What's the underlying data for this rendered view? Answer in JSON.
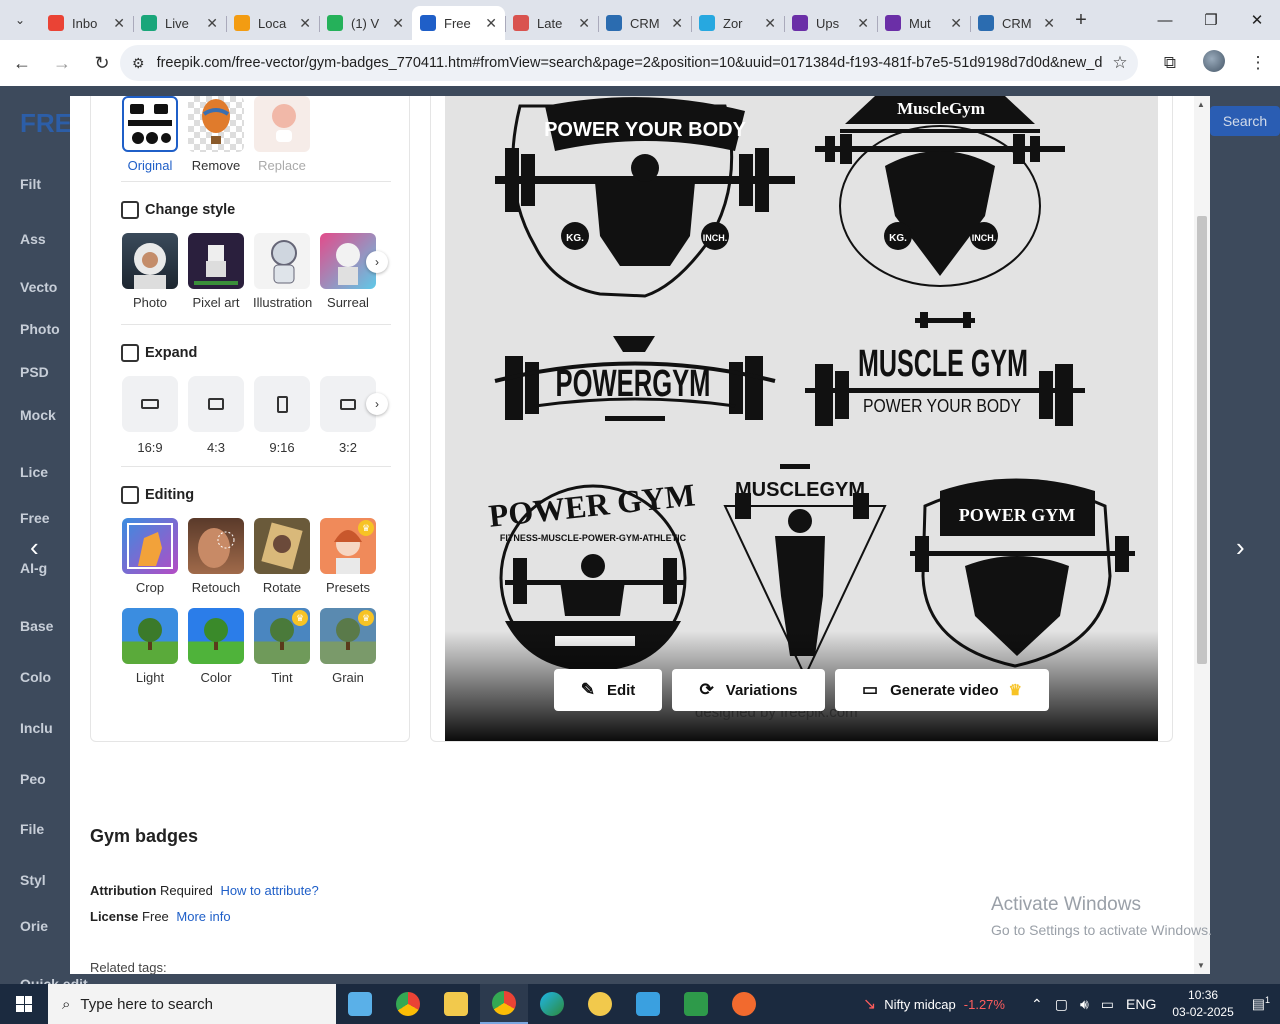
{
  "browser": {
    "tabs": [
      {
        "title": "Inbo",
        "icon": "gmail-icon",
        "color": "#ea4335",
        "active": false
      },
      {
        "title": "Live",
        "icon": "cb-icon",
        "color": "#1aa67a",
        "active": false
      },
      {
        "title": "Loca",
        "icon": "orange-circle-icon",
        "color": "#f39c12",
        "active": false
      },
      {
        "title": "(1) V",
        "icon": "whatsapp-icon",
        "color": "#25b15a",
        "active": false
      },
      {
        "title": "Free",
        "icon": "freepik-icon",
        "color": "#1f5fc8",
        "active": true
      },
      {
        "title": "Late",
        "icon": "maps-icon",
        "color": "#d9534f",
        "active": false
      },
      {
        "title": "CRM",
        "icon": "crm-icon",
        "color": "#2b6cb0",
        "active": false
      },
      {
        "title": "Zor",
        "icon": "zoho-icon",
        "color": "#27a8e0",
        "active": false
      },
      {
        "title": "Ups",
        "icon": "upwork-icon",
        "color": "#6b2fa7",
        "active": false
      },
      {
        "title": "Mut",
        "icon": "upwork-icon",
        "color": "#6b2fa7",
        "active": false
      },
      {
        "title": "CRM",
        "icon": "crm-icon",
        "color": "#2b6cb0",
        "active": false
      }
    ],
    "url": "freepik.com/free-vector/gym-badges_770411.htm#fromView=search&page=2&position=10&uuid=0171384d-f193-481f-b7e5-51d9198d7d0d&new_d..."
  },
  "background": {
    "sidebar": [
      "Filt",
      "Ass",
      "Vecto",
      "Photo",
      "PSD",
      "Mock",
      "Lice",
      "Free",
      "AI-g",
      "Base",
      "Colo",
      "Inclu",
      "Peo",
      "File",
      "Styl",
      "Orie",
      "Quick edit"
    ],
    "logo": "FRE",
    "right_button": "Search"
  },
  "panel": {
    "top_items": [
      {
        "label": "Original",
        "selected": true
      },
      {
        "label": "Remove",
        "selected": false
      },
      {
        "label": "Replace",
        "selected": false,
        "dim": true
      }
    ],
    "change_style": {
      "title": "Change style",
      "items": [
        "Photo",
        "Pixel art",
        "Illustration",
        "Surreal"
      ]
    },
    "expand": {
      "title": "Expand",
      "items": [
        "16:9",
        "4:3",
        "9:16",
        "3:2"
      ]
    },
    "editing": {
      "title": "Editing",
      "row1": [
        "Crop",
        "Retouch",
        "Rotate",
        "Presets"
      ],
      "row2": [
        "Light",
        "Color",
        "Tint",
        "Grain"
      ]
    }
  },
  "preview": {
    "badges": {
      "b1_top": "POWER YOUR BODY",
      "b1_left": "KG.",
      "b1_right": "INCH.",
      "b2_top": "MuscleGym",
      "b2_left": "KG.",
      "b2_right": "INCH.",
      "b3": "POWERGYM",
      "b4_main": "MUSCLE GYM",
      "b4_sub": "POWER YOUR BODY",
      "b5_arc": "POWER GYM",
      "b5_inner": "FITNESS-MUSCLE-POWER-GYM-ATHLETIC",
      "b6": "MUSCLEGYM",
      "b7": "POWER GYM"
    },
    "watermark": "designed by freepik.com",
    "actions": {
      "edit": "Edit",
      "variations": "Variations",
      "generate_video": "Generate video"
    }
  },
  "details": {
    "title": "Gym badges",
    "attribution_label": "Attribution",
    "attribution_value": "Required",
    "attribution_link": "How to attribute?",
    "license_label": "License",
    "license_value": "Free",
    "license_link": "More info",
    "related": "Related tags:"
  },
  "windows_notice": {
    "line1": "Activate Windows",
    "line2": "Go to Settings to activate Windows."
  },
  "taskbar": {
    "search_placeholder": "Type here to search",
    "nifty_label": "Nifty midcap",
    "nifty_change": "-1.27%",
    "language": "ENG",
    "time": "10:36",
    "date": "03-02-2025",
    "notifications": "1"
  }
}
